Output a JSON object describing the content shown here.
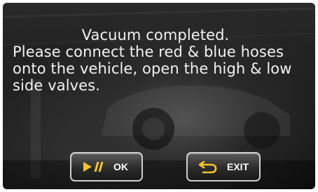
{
  "dialog": {
    "message_lines": [
      "Vacuum completed.",
      "Please connect the red & blue hoses",
      "onto the vehicle, open the high & low",
      "side valves."
    ]
  },
  "buttons": {
    "ok": {
      "label": "OK",
      "icon": "play-pause-icon"
    },
    "exit": {
      "label": "EXIT",
      "icon": "return-arrow-icon"
    }
  },
  "colors": {
    "icon_accent": "#f2c230",
    "text": "#f2f2f2"
  }
}
